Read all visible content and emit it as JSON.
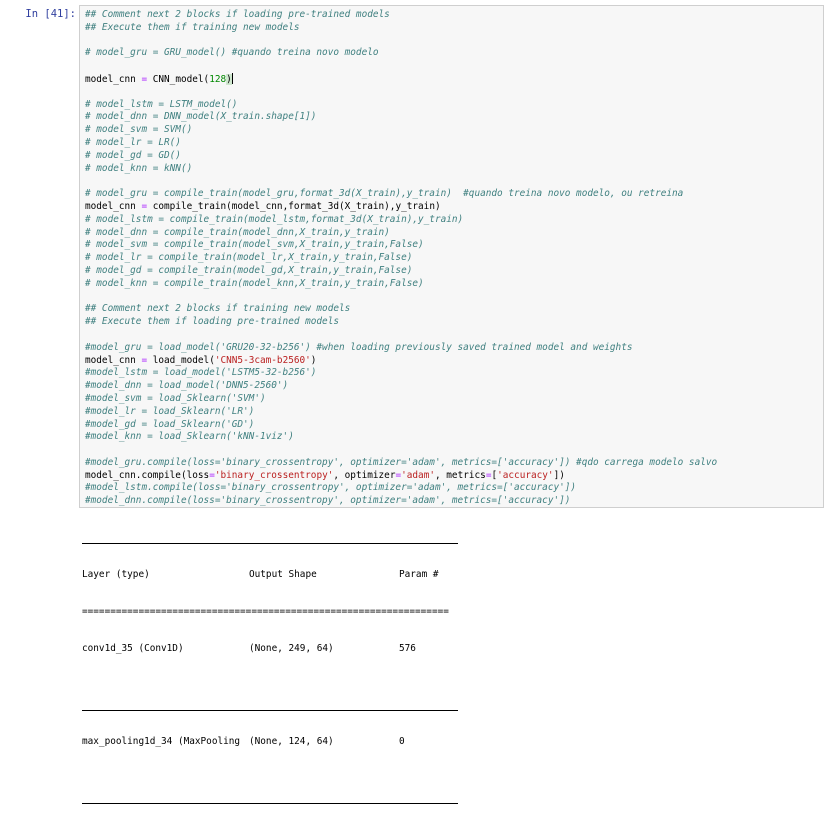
{
  "cell": {
    "prompt": "In [41]:"
  },
  "code_lines": [
    {
      "segments": [
        {
          "t": "## Comment next 2 blocks if loading pre-trained models",
          "c": "cm"
        }
      ]
    },
    {
      "segments": [
        {
          "t": "## Execute them if training new models",
          "c": "cm"
        }
      ]
    },
    {
      "segments": []
    },
    {
      "segments": [
        {
          "t": "# model_gru = GRU_model() #quando treina novo modelo",
          "c": "cm"
        }
      ]
    },
    {
      "segments": []
    },
    {
      "segments": [
        {
          "t": "model_cnn "
        },
        {
          "t": "=",
          "c": "op"
        },
        {
          "t": " CNN_model("
        },
        {
          "t": "128",
          "c": "nm"
        },
        {
          "t": ")",
          "c": "bracket"
        },
        {
          "caret": true
        }
      ]
    },
    {
      "segments": []
    },
    {
      "segments": [
        {
          "t": "# model_lstm = LSTM_model()",
          "c": "cm"
        }
      ]
    },
    {
      "segments": [
        {
          "t": "# model_dnn = DNN_model(X_train.shape[1])",
          "c": "cm"
        }
      ]
    },
    {
      "segments": [
        {
          "t": "# model_svm = SVM()",
          "c": "cm"
        }
      ]
    },
    {
      "segments": [
        {
          "t": "# model_lr = LR()",
          "c": "cm"
        }
      ]
    },
    {
      "segments": [
        {
          "t": "# model_gd = GD()",
          "c": "cm"
        }
      ]
    },
    {
      "segments": [
        {
          "t": "# model_knn = kNN()",
          "c": "cm"
        }
      ]
    },
    {
      "segments": []
    },
    {
      "segments": [
        {
          "t": "# model_gru = compile_train(model_gru,format_3d(X_train),y_train)  #quando treina novo modelo, ou retreina",
          "c": "cm"
        }
      ]
    },
    {
      "segments": [
        {
          "t": "model_cnn "
        },
        {
          "t": "=",
          "c": "op"
        },
        {
          "t": " compile_train(model_cnn,format_3d(X_train),y_train)"
        }
      ]
    },
    {
      "segments": [
        {
          "t": "# model_lstm = compile_train(model_lstm,format_3d(X_train),y_train)",
          "c": "cm"
        }
      ]
    },
    {
      "segments": [
        {
          "t": "# model_dnn = compile_train(model_dnn,X_train,y_train)",
          "c": "cm"
        }
      ]
    },
    {
      "segments": [
        {
          "t": "# model_svm = compile_train(model_svm,X_train,y_train,False)",
          "c": "cm"
        }
      ]
    },
    {
      "segments": [
        {
          "t": "# model_lr = compile_train(model_lr,X_train,y_train,False)",
          "c": "cm"
        }
      ]
    },
    {
      "segments": [
        {
          "t": "# model_gd = compile_train(model_gd,X_train,y_train,False)",
          "c": "cm"
        }
      ]
    },
    {
      "segments": [
        {
          "t": "# model_knn = compile_train(model_knn,X_train,y_train,False)",
          "c": "cm"
        }
      ]
    },
    {
      "segments": []
    },
    {
      "segments": [
        {
          "t": "## Comment next 2 blocks if training new models",
          "c": "cm"
        }
      ]
    },
    {
      "segments": [
        {
          "t": "## Execute them if loading pre-trained models",
          "c": "cm"
        }
      ]
    },
    {
      "segments": []
    },
    {
      "segments": [
        {
          "t": "#model_gru = load_model('GRU20-32-b256') #when loading previously saved trained model and weights",
          "c": "cm"
        }
      ]
    },
    {
      "segments": [
        {
          "t": "model_cnn "
        },
        {
          "t": "=",
          "c": "op"
        },
        {
          "t": " load_model("
        },
        {
          "t": "'CNN5-3cam-b2560'",
          "c": "st"
        },
        {
          "t": ")"
        }
      ]
    },
    {
      "segments": [
        {
          "t": "#model_lstm = load_model('LSTM5-32-b256')",
          "c": "cm"
        }
      ]
    },
    {
      "segments": [
        {
          "t": "#model_dnn = load_model('DNN5-2560')",
          "c": "cm"
        }
      ]
    },
    {
      "segments": [
        {
          "t": "#model_svm = load_Sklearn('SVM')",
          "c": "cm"
        }
      ]
    },
    {
      "segments": [
        {
          "t": "#model_lr = load_Sklearn('LR')",
          "c": "cm"
        }
      ]
    },
    {
      "segments": [
        {
          "t": "#model_gd = load_Sklearn('GD')",
          "c": "cm"
        }
      ]
    },
    {
      "segments": [
        {
          "t": "#model_knn = load_Sklearn('kNN-1viz')",
          "c": "cm"
        }
      ]
    },
    {
      "segments": []
    },
    {
      "segments": [
        {
          "t": "#model_gru.compile(loss='binary_crossentropy', optimizer='adam', metrics=['accuracy']) #qdo carrega modelo salvo",
          "c": "cm"
        }
      ]
    },
    {
      "segments": [
        {
          "t": "model_cnn.compile(loss"
        },
        {
          "t": "=",
          "c": "op"
        },
        {
          "t": "'binary_crossentropy'",
          "c": "st"
        },
        {
          "t": ", optimizer"
        },
        {
          "t": "=",
          "c": "op"
        },
        {
          "t": "'adam'",
          "c": "st"
        },
        {
          "t": ", metrics"
        },
        {
          "t": "=",
          "c": "op"
        },
        {
          "t": "["
        },
        {
          "t": "'accuracy'",
          "c": "st"
        },
        {
          "t": "])"
        }
      ]
    },
    {
      "segments": [
        {
          "t": "#model_lstm.compile(loss='binary_crossentropy', optimizer='adam', metrics=['accuracy'])",
          "c": "cm"
        }
      ]
    },
    {
      "segments": [
        {
          "t": "#model_dnn.compile(loss='binary_crossentropy', optimizer='adam', metrics=['accuracy'])",
          "c": "cm"
        }
      ]
    }
  ],
  "output": {
    "headers": [
      "Layer (type)",
      "Output Shape",
      "Param #"
    ],
    "double_rule": "=================================================================",
    "rows": [
      [
        "conv1d_35 (Conv1D)",
        "(None, 249, 64)",
        "576"
      ],
      [
        "max_pooling1d_34 (MaxPooling",
        "(None, 124, 64)",
        "0"
      ]
    ]
  }
}
